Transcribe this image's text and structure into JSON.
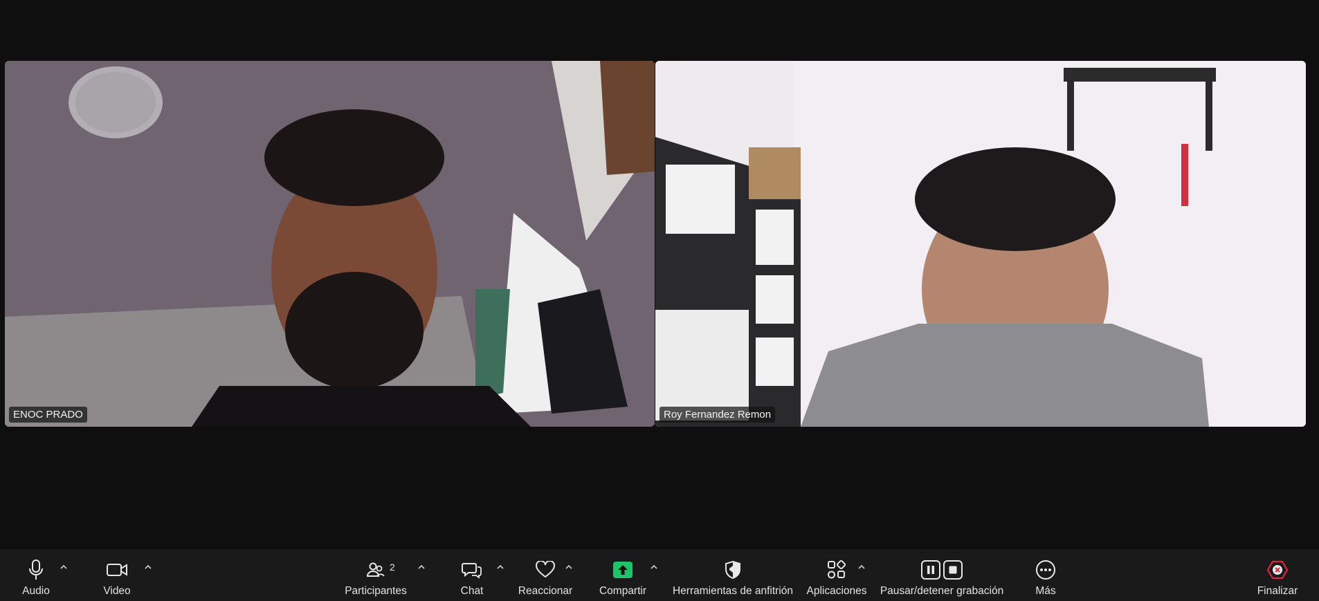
{
  "participants": [
    {
      "name": "ENOC PRADO"
    },
    {
      "name": "Roy Fernandez Remon"
    }
  ],
  "toolbar": {
    "audio_label": "Audio",
    "video_label": "Video",
    "participants_label": "Participantes",
    "participants_count": "2",
    "chat_label": "Chat",
    "react_label": "Reaccionar",
    "share_label": "Compartir",
    "host_tools_label": "Herramientas de anfitrión",
    "apps_label": "Aplicaciones",
    "recording_label": "Pausar/detener grabación",
    "more_label": "Más",
    "end_label": "Finalizar"
  },
  "colors": {
    "background": "#0f0f0f",
    "toolbar": "#1a1a1a",
    "share_accent": "#1fc36b",
    "end_accent": "#e0233a"
  }
}
